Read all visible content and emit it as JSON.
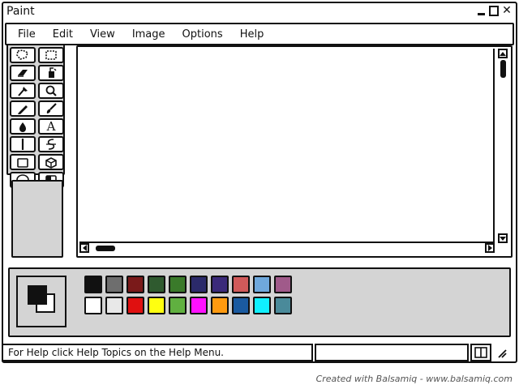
{
  "window": {
    "title": "Paint"
  },
  "menu": {
    "items": [
      {
        "label": "File"
      },
      {
        "label": "Edit"
      },
      {
        "label": "View"
      },
      {
        "label": "Image"
      },
      {
        "label": "Options"
      },
      {
        "label": "Help"
      }
    ]
  },
  "toolbox": {
    "tools": [
      {
        "icon": "free-select-icon"
      },
      {
        "icon": "rect-select-icon"
      },
      {
        "icon": "eraser-icon"
      },
      {
        "icon": "fill-bucket-icon"
      },
      {
        "icon": "color-picker-icon"
      },
      {
        "icon": "magnifier-icon"
      },
      {
        "icon": "pencil-icon"
      },
      {
        "icon": "brush-icon"
      },
      {
        "icon": "airbrush-icon"
      },
      {
        "icon": "text-icon",
        "label": "A"
      },
      {
        "icon": "line-icon"
      },
      {
        "icon": "curve-icon"
      },
      {
        "icon": "rectangle-icon"
      },
      {
        "icon": "polygon-icon"
      },
      {
        "icon": "ellipse-icon"
      },
      {
        "icon": "rounded-rect-icon"
      }
    ]
  },
  "palette": {
    "foreground": "#111111",
    "background": "#ffffff",
    "colors": [
      "#111111",
      "#6e6e6e",
      "#7a1a1a",
      "#2f5a2f",
      "#3a7a2a",
      "#2b2a6a",
      "#3b2a7a",
      "#d05a5a",
      "#6fa8dc",
      "#a05a8a",
      "#ffffff",
      "#e8e8e8",
      "#e01010",
      "#ffff10",
      "#60b040",
      "#ff10ff",
      "#ff9a10",
      "#1a5aa0",
      "#10f0ff",
      "#4a8a9a"
    ]
  },
  "status": {
    "help_text": "For Help click Help Topics on the Help Menu."
  },
  "footer": {
    "credit": "Created with Balsamiq - www.balsamiq.com"
  }
}
